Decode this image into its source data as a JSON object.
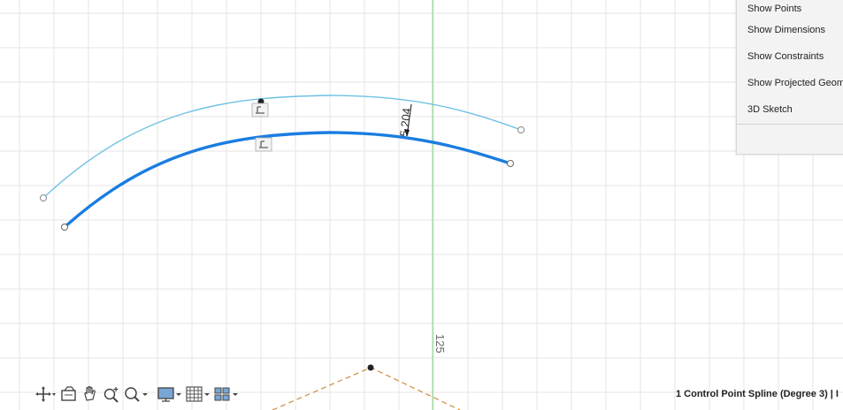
{
  "context_menu": {
    "items": [
      {
        "label": "Show Points"
      },
      {
        "label": "Show Dimensions"
      },
      {
        "label": "Show Constraints"
      },
      {
        "label": "Show Projected Geom"
      },
      {
        "label": "3D Sketch"
      }
    ]
  },
  "sketch": {
    "dimension_value": "5.204",
    "axis_label": "125"
  },
  "status_bar": {
    "selection_text": "1 Control Point Spline (Degree 3) | I"
  },
  "colors": {
    "grid_line": "#e6e6e6",
    "axis_green": "#7fd17f",
    "selected_spline": "#1a7de0",
    "offset_spline": "#6ec1e4",
    "construction_line": "#d08a3c"
  },
  "toolbar": {
    "icons": [
      "orbit-icon",
      "look-at-icon",
      "pan-icon",
      "zoom-icon",
      "zoom-window-icon",
      "display-settings-icon",
      "grid-icon",
      "viewports-icon"
    ]
  }
}
